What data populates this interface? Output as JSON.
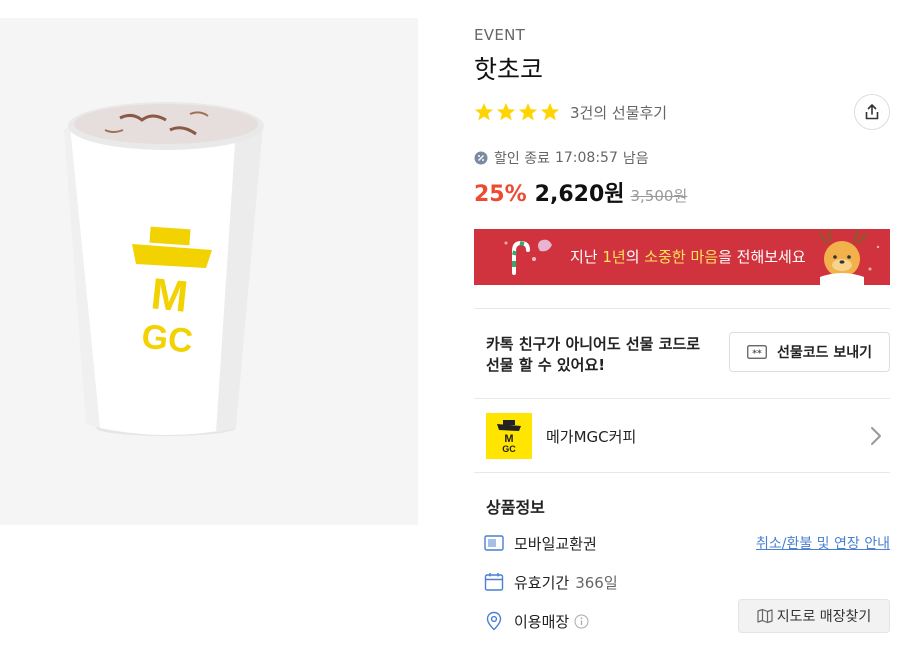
{
  "product": {
    "badge": "EVENT",
    "title": "핫초코",
    "rating": 5,
    "review_count_text": "3건의 선물후기",
    "timer_label": "할인 종료",
    "timer_time": "17:08:57",
    "timer_suffix": "남음",
    "discount": "25%",
    "sale_price": "2,620원",
    "original_price": "3,500원",
    "image_logo_text": "MGC"
  },
  "banner": {
    "prefix": "지난 ",
    "highlight1": "1년",
    "middle": "의 ",
    "highlight2": "소중한 마음",
    "suffix": "을 전해보세요",
    "bg_color": "#d1333e"
  },
  "gift": {
    "text_line1": "카톡 친구가 아니어도 선물 코드로",
    "text_line2": "선물 할 수 있어요!",
    "button_label": "선물코드 보내기"
  },
  "brand": {
    "name": "메가MGC커피",
    "logo_text": "MGC",
    "logo_color": "#ffe500"
  },
  "details": {
    "section_title": "상품정보",
    "voucher_type": "모바일교환권",
    "policy_link": "취소/환불 및 연장 안내",
    "validity_label": "유효기간",
    "validity_value": "366일",
    "store_label": "이용매장",
    "map_button": "지도로 매장찾기"
  },
  "colors": {
    "accent_red": "#ec4b32",
    "star": "#ffd400",
    "link": "#4a7fd1"
  }
}
